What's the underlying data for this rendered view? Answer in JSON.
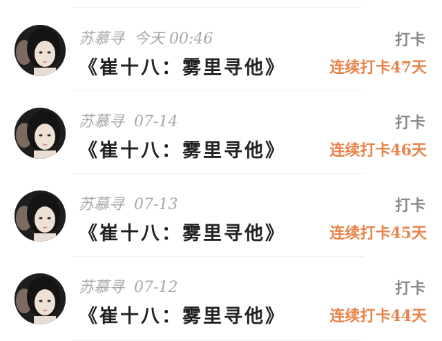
{
  "feed": {
    "items": [
      {
        "author": "苏慕寻",
        "date": "今天 00:46",
        "book": "《崔十八：雾里寻他》",
        "action_label": "打卡",
        "streak": "连续打卡47天"
      },
      {
        "author": "苏慕寻",
        "date": "07-14",
        "book": "《崔十八：雾里寻他》",
        "action_label": "打卡",
        "streak": "连续打卡46天"
      },
      {
        "author": "苏慕寻",
        "date": "07-13",
        "book": "《崔十八：雾里寻他》",
        "action_label": "打卡",
        "streak": "连续打卡45天"
      },
      {
        "author": "苏慕寻",
        "date": "07-12",
        "book": "《崔十八：雾里寻他》",
        "action_label": "打卡",
        "streak": "连续打卡44天"
      }
    ]
  },
  "colors": {
    "streak": "#e8844a",
    "meta": "#a8a8a8",
    "title": "#222222",
    "action": "#8a8a8a"
  },
  "icons": {
    "avatar": "user-avatar-photo"
  }
}
